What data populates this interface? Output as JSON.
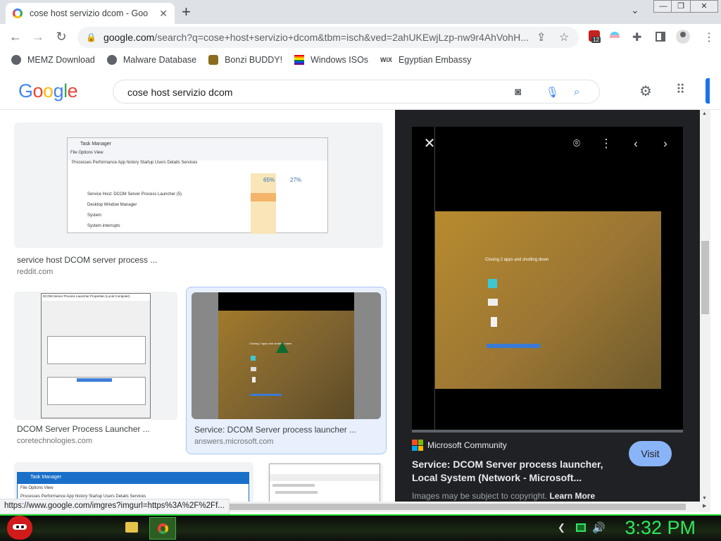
{
  "browser": {
    "tab_title": "cose host servizio dcom - Google",
    "tab_close": "✕",
    "new_tab": "+",
    "url_host": "google.com",
    "url_rest": "/search?q=cose+host+servizio+dcom&tbm=isch&ved=2ahUKEwjLzp-nw9r4AhVohH...",
    "extension_badge": "12"
  },
  "bookmarks": [
    {
      "label": "MEMZ Download"
    },
    {
      "label": "Malware Database"
    },
    {
      "label": "Bonzi BUDDY!"
    },
    {
      "label": "Windows ISOs"
    },
    {
      "label": "Egyptian Embassy"
    }
  ],
  "google": {
    "logo": "Google",
    "query": "cose host servizio dcom"
  },
  "results": [
    {
      "title": "service host DCOM server process ...",
      "domain": "reddit.com"
    },
    {
      "title": "DCOM Server Process Launcher ...",
      "domain": "coretechnologies.com"
    },
    {
      "title": "Service: DCOM Server process launcher ...",
      "domain": "answers.microsoft.com"
    }
  ],
  "thumb_text": {
    "tm_title": "Task Manager",
    "tm_menu": "File  Options  View",
    "tm_tabs": "Processes  Performance  App history  Startup  Users  Details  Services",
    "tm_cpu": "65%",
    "tm_mem": "27%",
    "tm_row1": "Service Host: DCOM Server Process Launcher (5)",
    "tm_row2": "Desktop Window Manager",
    "tm_row3": "System",
    "tm_row4": "System interrupts",
    "dcom_title": "DCOM Server Process Launcher Properties (Local Computer)",
    "win_dialog": "Closing 2 apps and shutting down"
  },
  "panel": {
    "source": "Microsoft Community",
    "title": "Service: DCOM Server process launcher, Local System (Network - Microsoft...",
    "visit": "Visit",
    "copyright": "Images may be subject to copyright.",
    "learn_more": "Learn More",
    "image_text": "Closing 2 apps and shutting down"
  },
  "status_url": "https://www.google.com/imgres?imgurl=https%3A%2F%2Ff...",
  "taskbar": {
    "clock": "3:32 PM"
  },
  "colors": {
    "accent": "#1a73e8",
    "visit_btn": "#8ab4f8",
    "clock": "#2fe85e"
  }
}
